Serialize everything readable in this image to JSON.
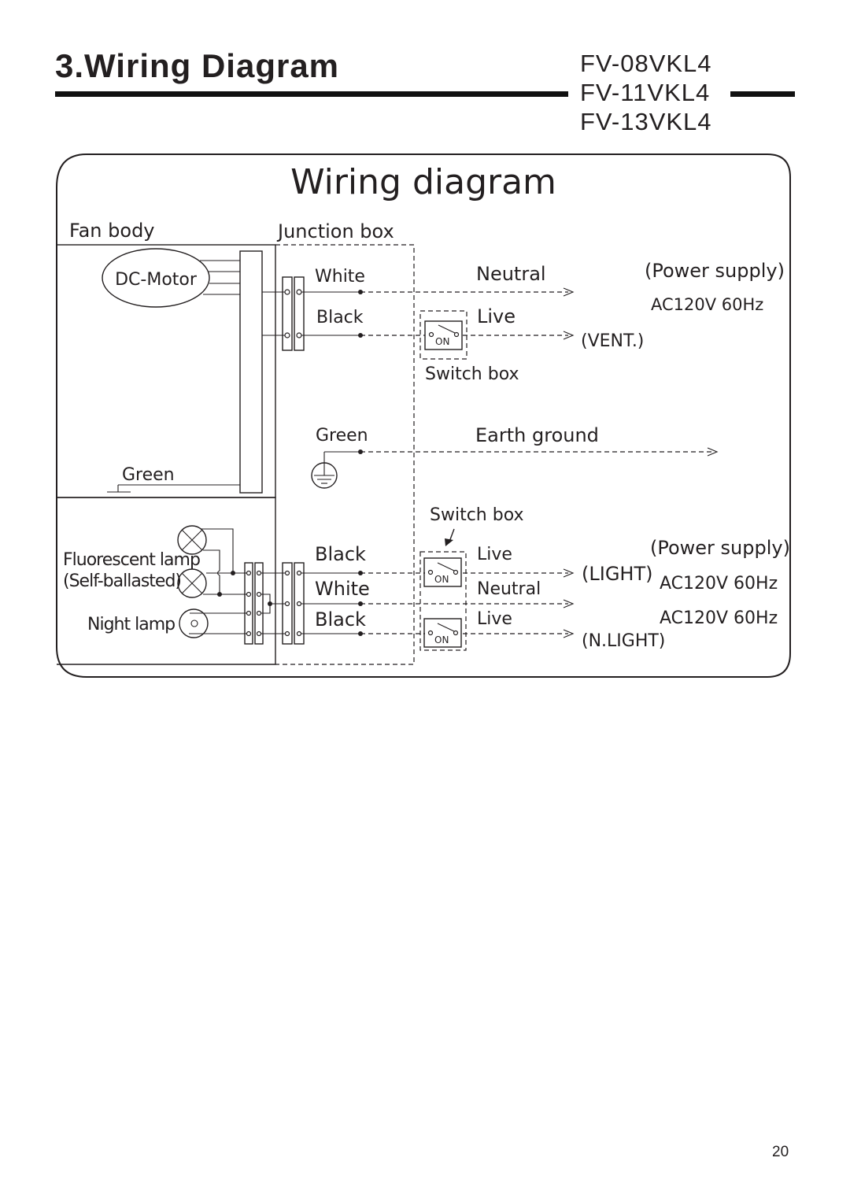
{
  "header": {
    "section_title": "3.Wiring Diagram",
    "models": [
      "FV-08VKL4",
      "FV-11VKL4",
      "FV-13VKL4"
    ]
  },
  "diagram": {
    "title": "Wiring diagram",
    "fan_body_label": "Fan body",
    "junction_box_label": "Junction box",
    "motor_label": "DC-Motor",
    "fan_ground_label": "Green",
    "fluorescent_lamp_label": "Fluorescent lamp",
    "fluorescent_lamp_sub": "(Self-ballasted)",
    "night_lamp_label": "Night lamp",
    "vent": {
      "wire_white": "White",
      "wire_black": "Black",
      "neutral": "Neutral",
      "live": "Live",
      "load": "(VENT.)",
      "switch_box": "Switch box",
      "switch_state": "ON",
      "power_supply": "(Power supply)",
      "voltage": "AC120V  60Hz"
    },
    "ground": {
      "wire": "Green",
      "label": "Earth ground"
    },
    "light": {
      "switch_box": "Switch box",
      "wire_black_1": "Black",
      "wire_white": "White",
      "wire_black_2": "Black",
      "live_1": "Live",
      "neutral": "Neutral",
      "live_2": "Live",
      "load_light": "(LIGHT)",
      "load_night": "(N.LIGHT)",
      "switch_state": "ON",
      "power_supply": "(Power supply)",
      "voltage_1": "AC120V  60Hz",
      "voltage_2": "AC120V  60Hz"
    }
  },
  "footer": {
    "page_number": "20"
  }
}
